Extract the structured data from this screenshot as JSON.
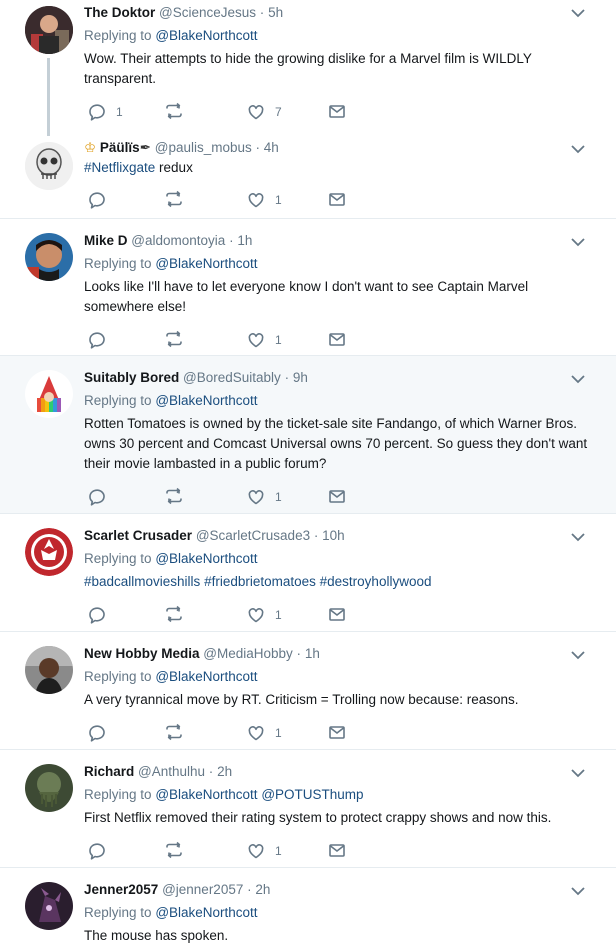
{
  "reply_prefix": "Replying to",
  "tweets": [
    {
      "name": "The Doktor",
      "handle": "@ScienceJesus",
      "time": "5h",
      "reply_to": [
        "@BlakeNorthcott"
      ],
      "text": "Wow. Their attempts to hide the growing dislike for a Marvel film is WILDLY transparent.",
      "replies": "1",
      "retweets": "",
      "likes": "7"
    },
    {
      "name": "Päülïs",
      "handle": "@paulis_mobus",
      "time": "4h",
      "text_hashtag": "#Netflixgate",
      "text": " redux",
      "replies": "",
      "retweets": "",
      "likes": "1"
    },
    {
      "name": "Mike D",
      "handle": "@aldomontoyia",
      "time": "1h",
      "reply_to": [
        "@BlakeNorthcott"
      ],
      "text": "Looks like I'll have to let everyone know I don't want to see Captain Marvel somewhere else!",
      "replies": "",
      "retweets": "",
      "likes": "1"
    },
    {
      "name": "Suitably Bored",
      "handle": "@BoredSuitably",
      "time": "9h",
      "reply_to": [
        "@BlakeNorthcott"
      ],
      "text": "Rotten Tomatoes is owned by the ticket-sale site Fandango, of which Warner Bros. owns 30 percent and Comcast Universal owns 70 percent. So  guess they don't want their movie lambasted in a public forum?",
      "replies": "",
      "retweets": "",
      "likes": "1"
    },
    {
      "name": "Scarlet Crusader",
      "handle": "@ScarletCrusade3",
      "time": "10h",
      "reply_to": [
        "@BlakeNorthcott"
      ],
      "hashtags": [
        "#badcallmovieshills",
        "#friedbrietomatoes",
        "#destroyhollywood"
      ],
      "replies": "",
      "retweets": "",
      "likes": "1"
    },
    {
      "name": "New Hobby Media",
      "handle": "@MediaHobby",
      "time": "1h",
      "reply_to": [
        "@BlakeNorthcott"
      ],
      "text": "A very tyrannical move by RT. Criticism = Trolling now because: reasons.",
      "replies": "",
      "retweets": "",
      "likes": "1"
    },
    {
      "name": "Richard",
      "handle": "@Anthulhu",
      "time": "2h",
      "reply_to": [
        "@BlakeNorthcott",
        "@POTUSThump"
      ],
      "text": "First Netflix removed their rating system to protect crappy shows and now this.",
      "replies": "",
      "retweets": "",
      "likes": "1"
    },
    {
      "name": "Jenner2057",
      "handle": "@jenner2057",
      "time": "2h",
      "reply_to": [
        "@BlakeNorthcott"
      ],
      "text": "The mouse has spoken."
    }
  ],
  "icons": [
    "reply-icon",
    "retweet-icon",
    "like-icon",
    "message-icon",
    "chevron-down-icon"
  ],
  "colors": {
    "link": "#1b4e7f",
    "muted": "#657786",
    "highlight_bg": "#f5f8fa",
    "divider": "#e6ecf0"
  }
}
